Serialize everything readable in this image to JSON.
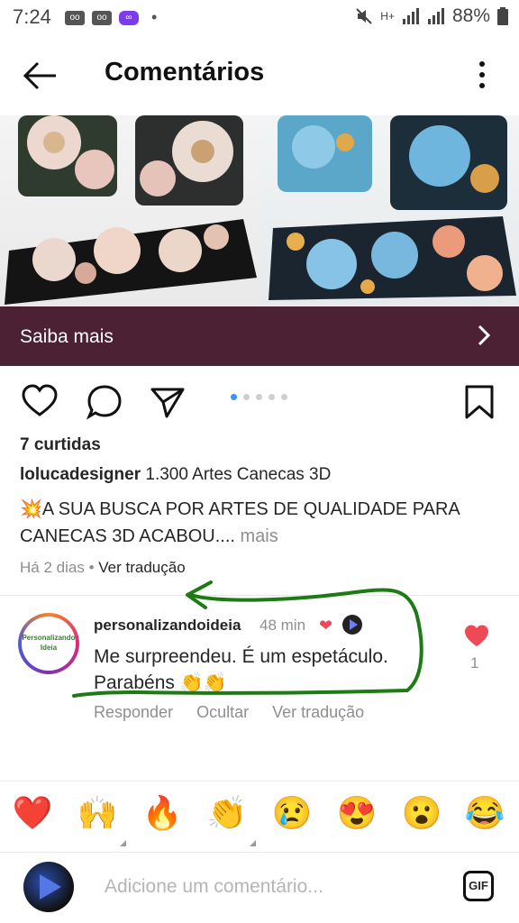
{
  "status_bar": {
    "time": "7:24",
    "battery": "88%",
    "network": "H+"
  },
  "app_bar": {
    "title": "Comentários"
  },
  "ad": {
    "cta_label": "Saiba mais"
  },
  "post": {
    "likes": "7 curtidas",
    "username": "lolucadesigner",
    "caption_line1": " 1.300 Artes Canecas 3D",
    "caption_body": "💥A SUA BUSCA POR ARTES DE QUALIDADE PARA CANECAS 3D ACABOU....",
    "more_label": " mais",
    "time_ago": "Há 2 dias",
    "translate": "Ver tradução",
    "carousel_dots": 5,
    "carousel_active": 0
  },
  "comment": {
    "username": "personalizandoideia",
    "time": "48 min",
    "text": "Me surpreendeu. É um espetáculo. Parabéns 👏👏",
    "reply": "Responder",
    "hide": "Ocultar",
    "translate": "Ver tradução",
    "like_count": "1",
    "avatar_text": "Personalizando Ideia"
  },
  "emoji_bar": [
    "❤️",
    "🙌",
    "🔥",
    "👏",
    "😢",
    "😍",
    "😮",
    "😂"
  ],
  "composer": {
    "placeholder": "Adicione um comentário...",
    "gif_label": "GIF"
  },
  "colors": {
    "cta_bg": "#4b2133",
    "accent_blue": "#3897f0",
    "like_red": "#ed4956",
    "annotation_green": "#1e7a14"
  }
}
